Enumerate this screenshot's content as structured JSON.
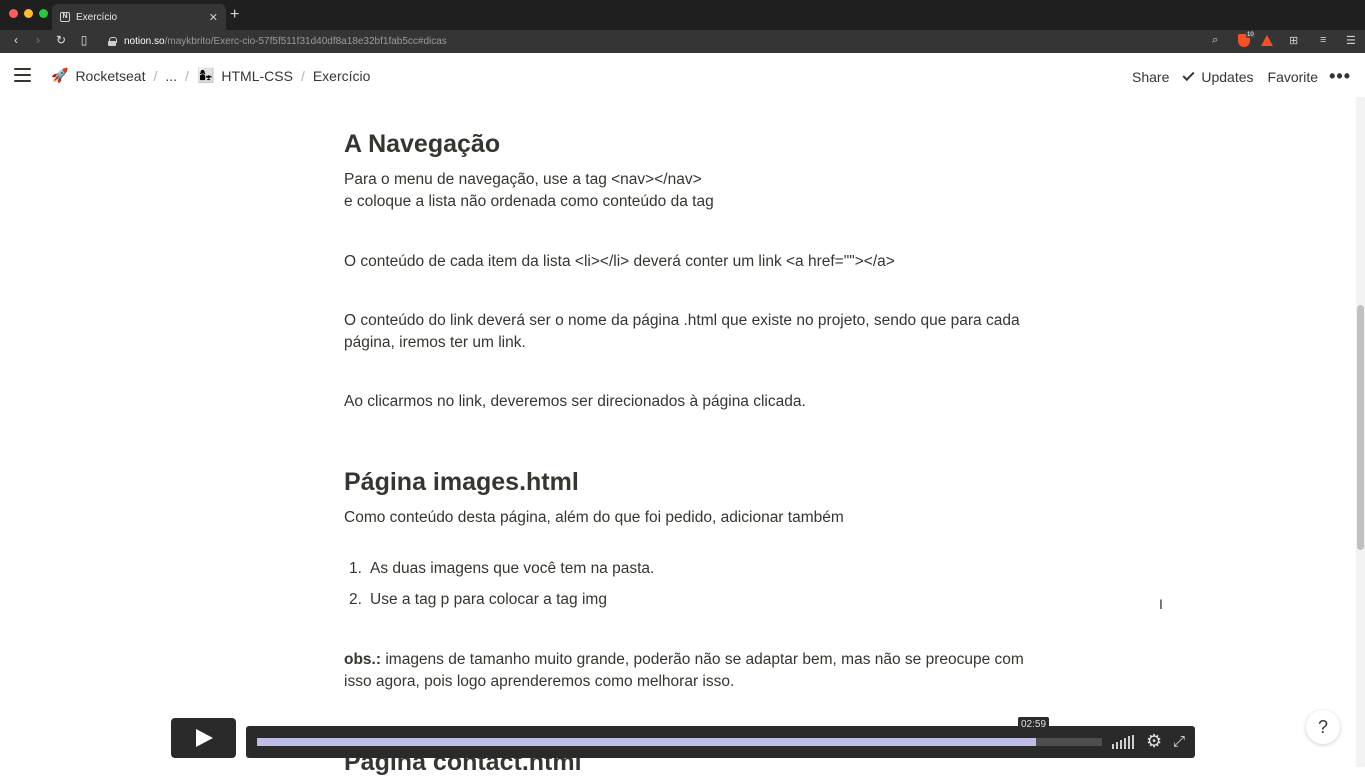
{
  "browser": {
    "tab_title": "Exercício",
    "url_host": "notion.so",
    "url_path": "/maykbrito/Exerc-cio-57f5f511f31d40df8a18e32bf1fab5cc#dicas",
    "shield_badge": "10",
    "colors": {
      "close": "#ff5f57",
      "minimize": "#febc2e",
      "maximize": "#28c840"
    }
  },
  "topbar": {
    "breadcrumbs": [
      {
        "emoji": "🚀",
        "label": "Rocketseat"
      },
      {
        "label": "..."
      },
      {
        "emoji": "👩‍👧",
        "label": "HTML-CSS"
      },
      {
        "label": "Exercício"
      }
    ],
    "share": "Share",
    "updates": "Updates",
    "favorite": "Favorite",
    "more": "•••"
  },
  "content": {
    "nav_heading": "A Navegação",
    "nav_p1_line1": "Para o menu de navegação, use a tag <nav></nav>",
    "nav_p1_line2": "e coloque a lista não ordenada como conteúdo da tag",
    "nav_p2": "O conteúdo de cada item da lista <li></li> deverá conter um link <a href=\"\"></a>",
    "nav_p3_line1": "O conteúdo do link deverá ser o nome da página .html que existe no projeto, sendo que para cada",
    "nav_p3_line2": "página, iremos ter um link.",
    "nav_p4": "Ao clicarmos no link, deveremos ser direcionados à página clicada.",
    "images_heading": "Página images.html",
    "images_intro": "Como conteúdo desta página, além do que foi pedido, adicionar também",
    "images_list": [
      {
        "num": "1.",
        "text": "As duas imagens que você tem na pasta."
      },
      {
        "num": "2.",
        "text": "Use a tag p para colocar a tag img"
      }
    ],
    "obs_label": "obs.:",
    "obs_line1": " imagens de tamanho muito grande, poderão não se adaptar bem, mas não se preocupe com",
    "obs_line2": "isso agora, pois logo aprenderemos como melhorar isso.",
    "contact_heading": "Página contact.html"
  },
  "player": {
    "time": "02:59",
    "progress": 0.922
  },
  "help": "?"
}
